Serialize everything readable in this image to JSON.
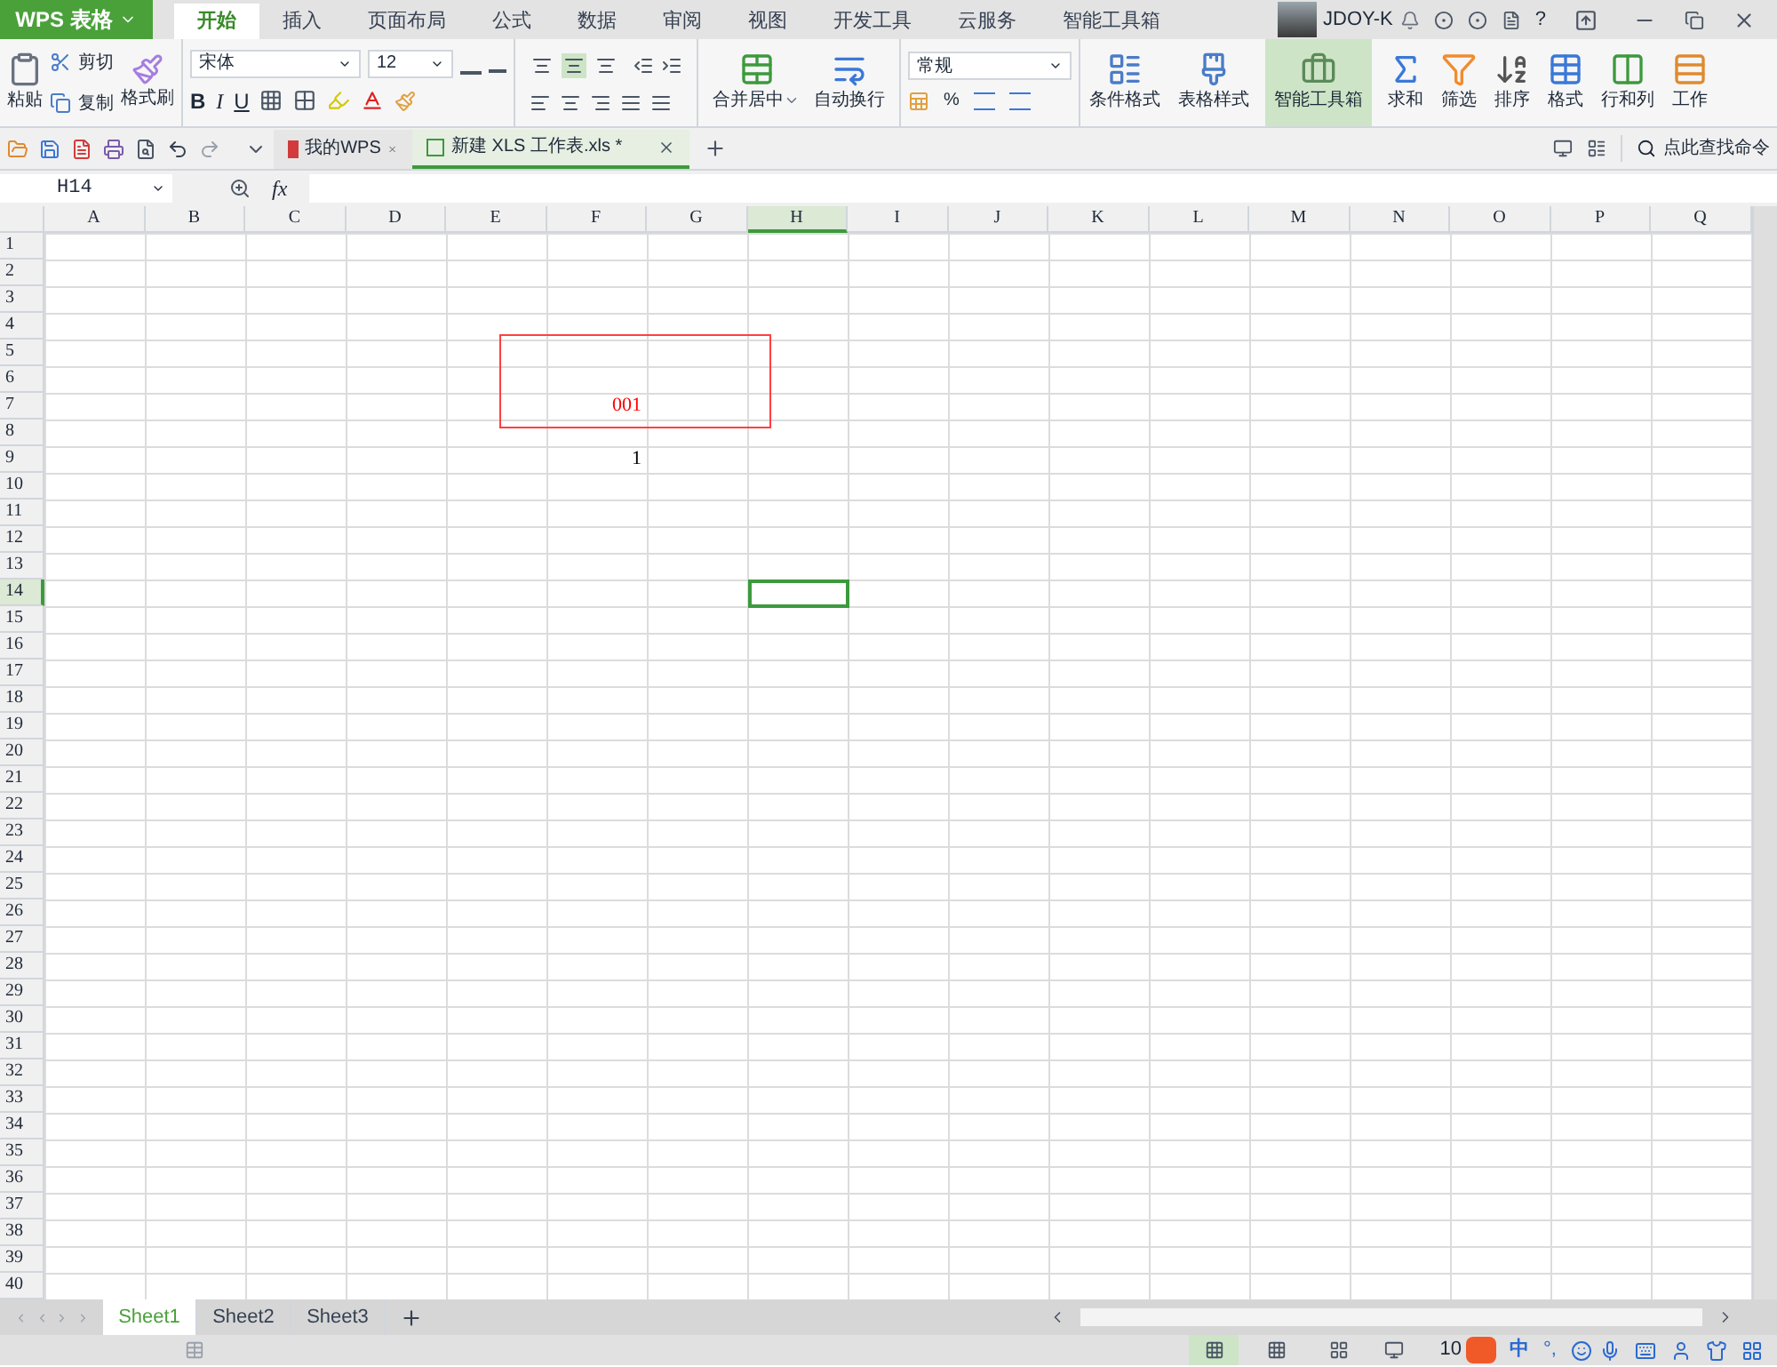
{
  "app_menu": "WPS 表格",
  "menu_tabs": [
    {
      "label": "开始",
      "selected": true
    },
    {
      "label": "插入",
      "selected": false
    },
    {
      "label": "页面布局",
      "selected": false
    },
    {
      "label": "公式",
      "selected": false
    },
    {
      "label": "数据",
      "selected": false
    },
    {
      "label": "审阅",
      "selected": false
    },
    {
      "label": "视图",
      "selected": false
    },
    {
      "label": "开发工具",
      "selected": false
    },
    {
      "label": "云服务",
      "selected": false
    },
    {
      "label": "智能工具箱",
      "selected": false
    }
  ],
  "user": "JDOY-K",
  "help": "?",
  "clipboard": {
    "paste": "粘贴",
    "cut": "剪切",
    "copy": "复制",
    "painter": "格式刷"
  },
  "font": {
    "name": "宋体",
    "size": "12",
    "bold": "B",
    "italic": "I",
    "underline": "U"
  },
  "alignment_buttons": [
    {
      "selected": false
    },
    {
      "selected": true
    },
    {
      "selected": false
    }
  ],
  "merge": "合并居中",
  "wrap": "自动换行",
  "number": {
    "format": "常规",
    "percent": "%"
  },
  "tools": [
    {
      "label": "条件格式",
      "selected": false
    },
    {
      "label": "表格样式",
      "selected": false
    },
    {
      "label": "智能工具箱",
      "selected": true
    },
    {
      "label": "求和",
      "selected": false
    },
    {
      "label": "筛选",
      "selected": false
    },
    {
      "label": "排序",
      "selected": false
    },
    {
      "label": "格式",
      "selected": false
    },
    {
      "label": "行和列",
      "selected": false
    },
    {
      "label": "工作",
      "selected": false
    }
  ],
  "doc_tabs": [
    {
      "label": "我的WPS",
      "selected": false
    },
    {
      "label": "新建 XLS 工作表.xls *",
      "selected": true
    }
  ],
  "search_command": "点此查找命令",
  "name_box": "H14",
  "fx": "fx",
  "columns": [
    {
      "label": "A",
      "selected": false
    },
    {
      "label": "B",
      "selected": false
    },
    {
      "label": "C",
      "selected": false
    },
    {
      "label": "D",
      "selected": false
    },
    {
      "label": "E",
      "selected": false
    },
    {
      "label": "F",
      "selected": false
    },
    {
      "label": "G",
      "selected": false
    },
    {
      "label": "H",
      "selected": true
    },
    {
      "label": "I",
      "selected": false
    },
    {
      "label": "J",
      "selected": false
    },
    {
      "label": "K",
      "selected": false
    },
    {
      "label": "L",
      "selected": false
    },
    {
      "label": "M",
      "selected": false
    },
    {
      "label": "N",
      "selected": false
    },
    {
      "label": "O",
      "selected": false
    },
    {
      "label": "P",
      "selected": false
    },
    {
      "label": "Q",
      "selected": false
    }
  ],
  "rows": [
    {
      "label": "1",
      "selected": false
    },
    {
      "label": "2",
      "selected": false
    },
    {
      "label": "3",
      "selected": false
    },
    {
      "label": "4",
      "selected": false
    },
    {
      "label": "5",
      "selected": false
    },
    {
      "label": "6",
      "selected": false
    },
    {
      "label": "7",
      "selected": false,
      "cells": [
        null,
        null,
        null,
        null,
        null,
        {
          "text": "001",
          "color": "#ff0000"
        }
      ]
    },
    {
      "label": "8",
      "selected": false
    },
    {
      "label": "9",
      "selected": false,
      "cells": [
        null,
        null,
        null,
        null,
        null,
        {
          "text": "1",
          "color": "#000000"
        }
      ]
    },
    {
      "label": "10",
      "selected": false
    },
    {
      "label": "11",
      "selected": false
    },
    {
      "label": "12",
      "selected": false
    },
    {
      "label": "13",
      "selected": false
    },
    {
      "label": "14",
      "selected": true
    },
    {
      "label": "15",
      "selected": false
    },
    {
      "label": "16",
      "selected": false
    },
    {
      "label": "17",
      "selected": false
    },
    {
      "label": "18",
      "selected": false
    },
    {
      "label": "19",
      "selected": false
    },
    {
      "label": "20",
      "selected": false
    },
    {
      "label": "21",
      "selected": false
    },
    {
      "label": "22",
      "selected": false
    },
    {
      "label": "23",
      "selected": false
    },
    {
      "label": "24",
      "selected": false
    },
    {
      "label": "25",
      "selected": false
    },
    {
      "label": "26",
      "selected": false
    },
    {
      "label": "27",
      "selected": false
    },
    {
      "label": "28",
      "selected": false
    },
    {
      "label": "29",
      "selected": false
    },
    {
      "label": "30",
      "selected": false
    },
    {
      "label": "31",
      "selected": false
    },
    {
      "label": "32",
      "selected": false
    },
    {
      "label": "33",
      "selected": false
    },
    {
      "label": "34",
      "selected": false
    },
    {
      "label": "35",
      "selected": false
    },
    {
      "label": "36",
      "selected": false
    },
    {
      "label": "37",
      "selected": false
    },
    {
      "label": "38",
      "selected": false
    },
    {
      "label": "39",
      "selected": false
    },
    {
      "label": "40",
      "selected": false
    }
  ],
  "sheets": [
    {
      "label": "Sheet1",
      "selected": true
    },
    {
      "label": "Sheet2",
      "selected": false
    },
    {
      "label": "Sheet3",
      "selected": false
    }
  ],
  "status": {
    "zoom": "10",
    "ime": "中",
    "ime_punct": "°,"
  }
}
